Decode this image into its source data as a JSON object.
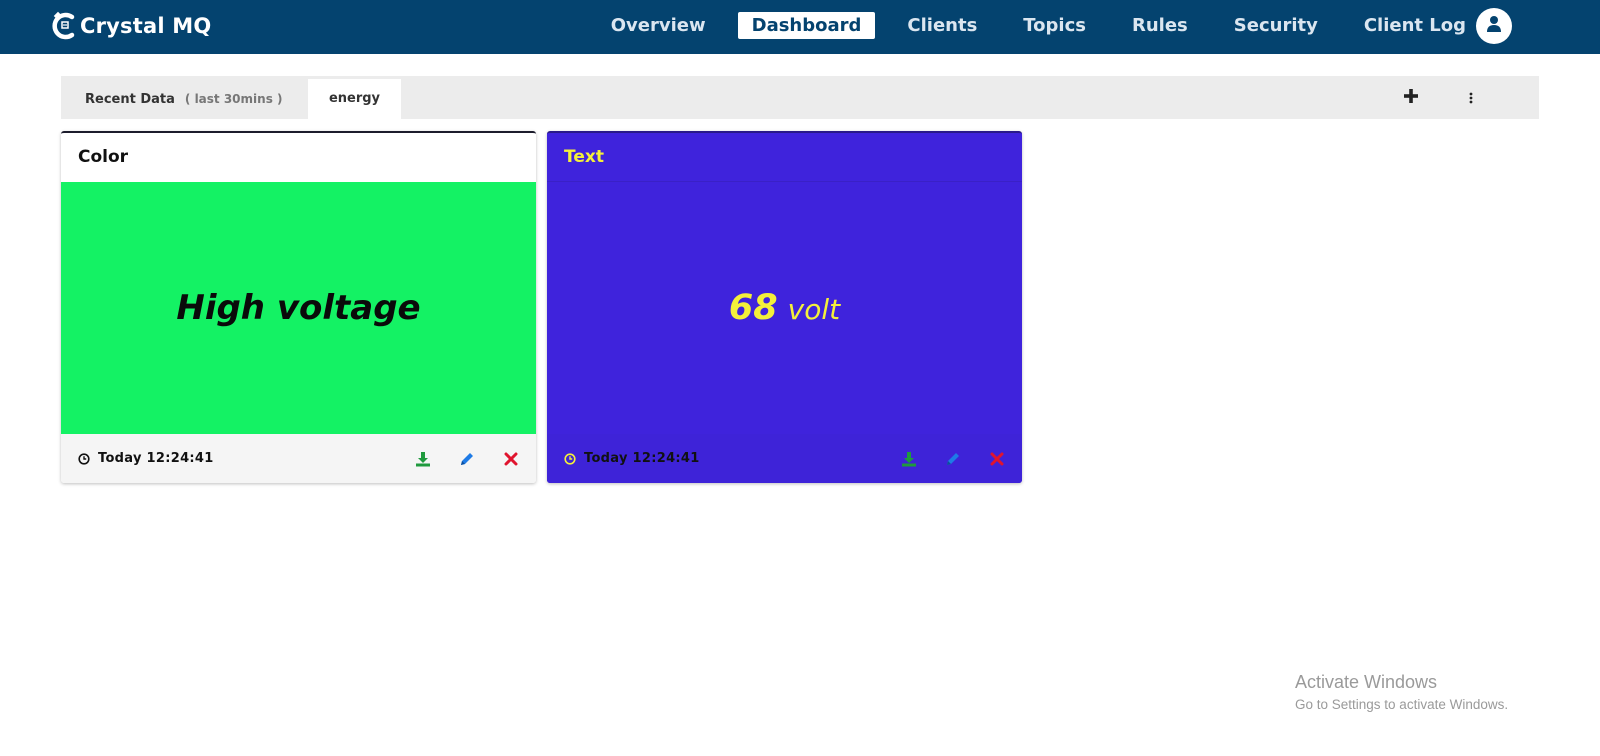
{
  "app": {
    "brand": "Crystal MQ"
  },
  "nav": {
    "items": [
      {
        "label": "Overview",
        "active": false
      },
      {
        "label": "Dashboard",
        "active": true
      },
      {
        "label": "Clients",
        "active": false
      },
      {
        "label": "Topics",
        "active": false
      },
      {
        "label": "Rules",
        "active": false
      },
      {
        "label": "Security",
        "active": false
      },
      {
        "label": "Client Log",
        "active": false
      }
    ],
    "avatar_icon": "user-icon"
  },
  "tabs": {
    "recent": {
      "label": "Recent Data",
      "sub": "( last 30mins )"
    },
    "energy": {
      "label": "energy"
    },
    "add_icon": "plus-icon",
    "menu_icon": "vertical-dots-icon"
  },
  "widgets": {
    "color": {
      "title": "Color",
      "value_text": "High voltage",
      "timestamp": "Today 12:24:41",
      "bg": "#14f264"
    },
    "text": {
      "title": "Text",
      "value": "68",
      "unit": "volt",
      "timestamp": "Today 12:24:41",
      "bg": "#3f23dc",
      "fg": "#f4f03a"
    },
    "action_icons": [
      "download-icon",
      "edit-icon",
      "delete-icon"
    ]
  },
  "watermark": {
    "title": "Activate Windows",
    "subtitle": "Go to Settings to activate Windows."
  }
}
